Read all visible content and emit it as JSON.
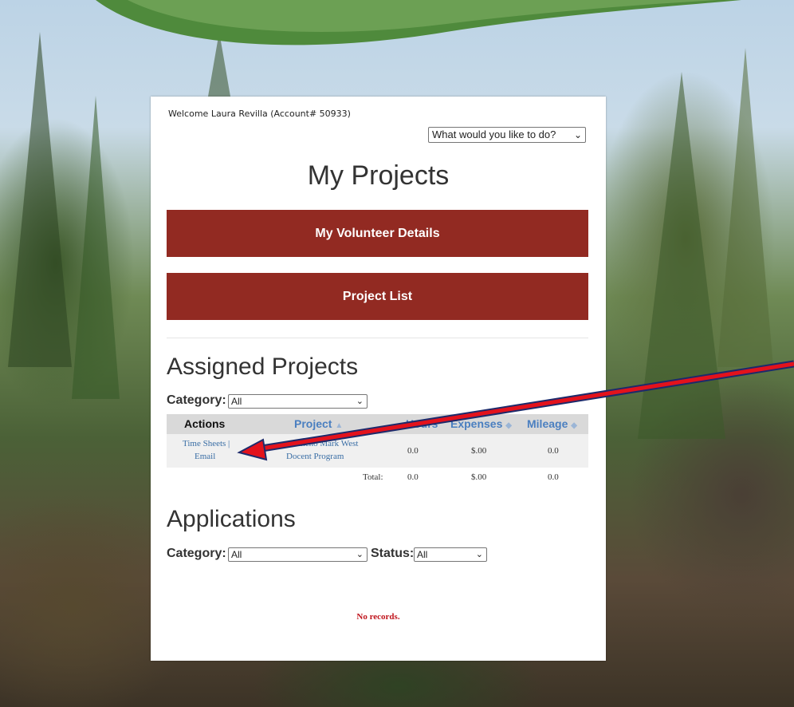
{
  "header": {
    "welcome": "Welcome Laura Revilla (Account# 50933)",
    "action_menu": {
      "value": "What would you like to do?",
      "icon": "chevron-down-icon"
    }
  },
  "page_title": "My Projects",
  "buttons": {
    "volunteer_details": "My Volunteer Details",
    "project_list": "Project List"
  },
  "assigned": {
    "title": "Assigned Projects",
    "category_label": "Category:",
    "category_value": "All",
    "columns": {
      "actions": "Actions",
      "project": "Project",
      "hours": "Hours",
      "expenses": "Expenses",
      "mileage": "Mileage"
    },
    "rows": [
      {
        "action_timesheets": "Time Sheets |",
        "action_email": "Email",
        "project_line1": "Rancho Mark West",
        "project_line2": "Docent Program",
        "hours": "0.0",
        "expenses": "$.00",
        "mileage": "0.0"
      }
    ],
    "total": {
      "label": "Total:",
      "hours": "0.0",
      "expenses": "$.00",
      "mileage": "0.0"
    }
  },
  "applications": {
    "title": "Applications",
    "category_label": "Category:",
    "category_value": "All",
    "status_label": "Status:",
    "status_value": "All",
    "empty_message": "No records."
  },
  "colors": {
    "button_bg": "#922a22",
    "link": "#3a6ea5",
    "header_link": "#4a7fc0",
    "empty_message": "#c0141c",
    "annotation_arrow": "#e3121c"
  }
}
